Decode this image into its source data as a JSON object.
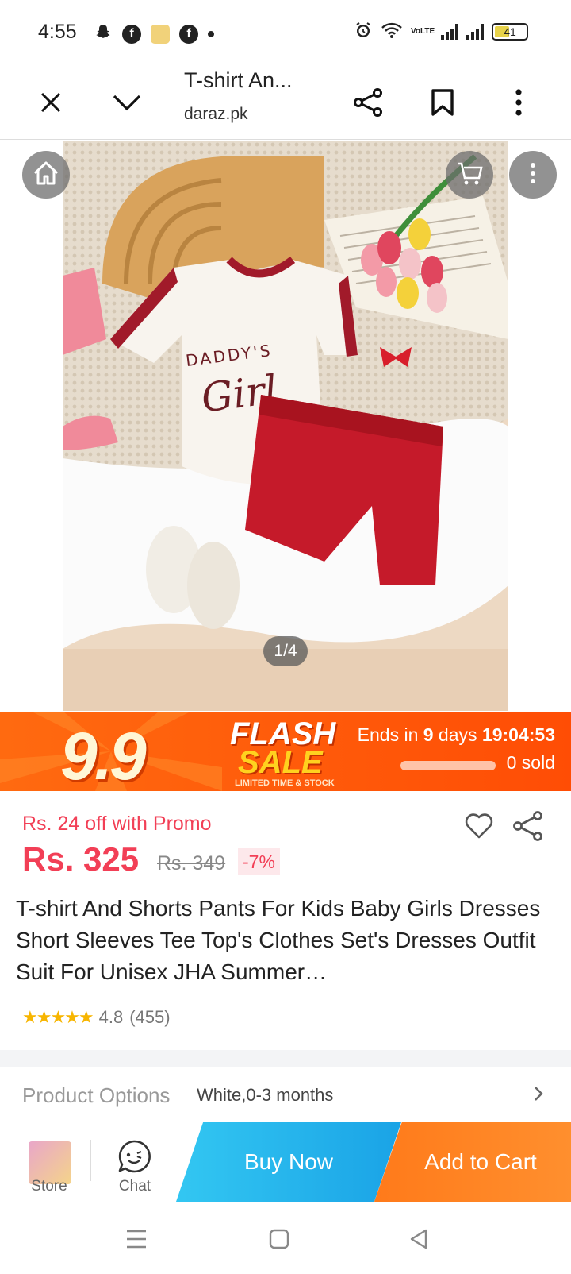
{
  "status_bar": {
    "time": "4:55",
    "battery": "41",
    "network_label": "VoLTE"
  },
  "browser": {
    "title": "T-shirt An...",
    "domain": "daraz.pk",
    "icons": [
      "close-icon",
      "chevron-down-icon",
      "share-icon",
      "bookmark-icon",
      "more-vertical-icon"
    ]
  },
  "gallery": {
    "counter": "1/4",
    "overlay_icons": [
      "home-icon",
      "cart-icon",
      "more-vertical-icon"
    ],
    "shirt_text_1": "DADDY'S",
    "shirt_text_2": "Girl"
  },
  "flash_sale": {
    "badge": "9.9",
    "title_1": "FLASH",
    "title_2": "SALE",
    "subtitle": "LIMITED TIME & STOCK",
    "ends_prefix": "Ends in ",
    "ends_days": "9",
    "ends_days_suffix": " days ",
    "ends_time": "19:04:53",
    "sold": "0 sold",
    "sold_progress": 0
  },
  "pricing": {
    "promo": "Rs. 24 off with Promo",
    "price": "Rs. 325",
    "old_price": "Rs. 349",
    "discount": "-7%"
  },
  "product": {
    "title": "T-shirt And Shorts Pants For Kids Baby Girls Dresses Short Sleeves Tee Top's Clothes Set's Dresses Outfit Suit For Unisex JHA Summer…",
    "rating_value": "4.8",
    "rating_count": "(455)",
    "stars": 4.8
  },
  "options": {
    "label": "Product Options",
    "value": "White,0-3 months"
  },
  "action_bar": {
    "store_label": "Store",
    "chat_label": "Chat",
    "buy_now": "Buy Now",
    "add_to_cart": "Add to Cart"
  },
  "colors": {
    "accent_red": "#f23f56",
    "flash_orange": "#ff5a0a",
    "buy_blue": "#1aa3e6",
    "cart_orange": "#ff8426"
  }
}
